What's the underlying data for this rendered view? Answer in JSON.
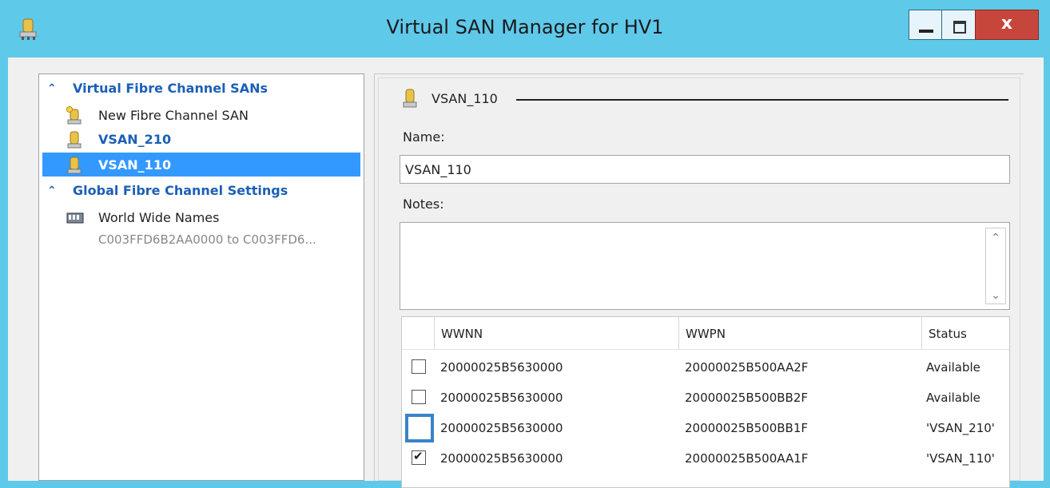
{
  "window": {
    "title": "Virtual SAN Manager for HV1",
    "close_glyph": "x"
  },
  "left": {
    "section1": "Virtual Fibre Channel SANs",
    "new_san": "New Fibre Channel SAN",
    "san_a": "VSAN_210",
    "san_b": "VSAN_110",
    "section2": "Global Fibre Channel Settings",
    "wwn_label": "World Wide Names",
    "wwn_range": "C003FFD6B2AA0000 to C003FFD6..."
  },
  "right": {
    "header": "VSAN_110",
    "name_label": "Name:",
    "name_value": "VSAN_110",
    "notes_label": "Notes:",
    "table": {
      "headers": [
        "WWNN",
        "WWPN",
        "Status"
      ],
      "rows": [
        {
          "checked": false,
          "wwnn": "20000025B5630000",
          "wwpn": "20000025B500AA2F",
          "status": "Available"
        },
        {
          "checked": false,
          "wwnn": "20000025B5630000",
          "wwpn": "20000025B500BB2F",
          "status": "Available"
        },
        {
          "checked": false,
          "wwnn": "20000025B5630000",
          "wwpn": "20000025B500BB1F",
          "status": "'VSAN_210'"
        },
        {
          "checked": true,
          "wwnn": "20000025B5630000",
          "wwpn": "20000025B500AA1F",
          "status": "'VSAN_110'"
        }
      ]
    }
  },
  "colors": {
    "titlebar": "#5fc9ea",
    "selection": "#3399ff",
    "section_text": "#1c5fb5",
    "close": "#c7463c"
  }
}
